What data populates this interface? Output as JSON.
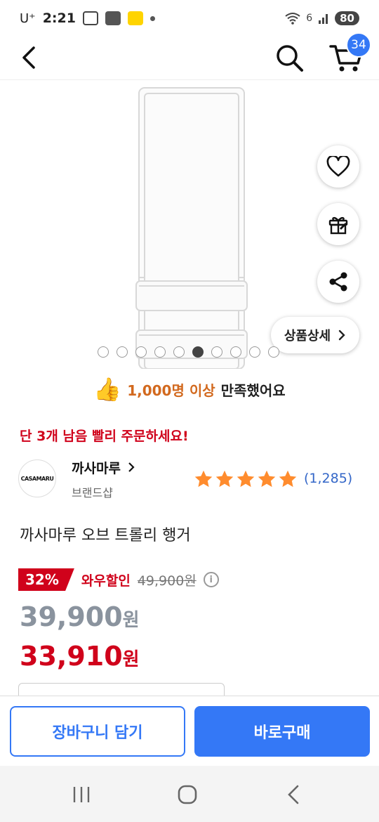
{
  "status_bar": {
    "carrier": "U⁺",
    "time": "2:21",
    "battery": "80",
    "sig_label": "6"
  },
  "header": {
    "cart_count": "34"
  },
  "gallery": {
    "total_images": 10,
    "active_index": 6,
    "detail_label": "상품상세"
  },
  "satisfaction": {
    "count": "1,000명 이상",
    "text": "만족했어요"
  },
  "stock_notice": "단 3개 남음 빨리 주문하세요!",
  "brand": {
    "logo_text": "CASAMARU",
    "name": "까사마루",
    "subtitle": "브랜드샵"
  },
  "rating": {
    "stars": 5,
    "review_count": "(1,285)"
  },
  "product": {
    "title": "까사마루 오브 트롤리 행거"
  },
  "pricing": {
    "discount": "32%",
    "wow_label": "와우할인",
    "original_price": "49,900원",
    "price_gray": "39,900",
    "price_red": "33,910",
    "won": "원"
  },
  "actions": {
    "add_to_cart": "장바구니 담기",
    "buy_now": "바로구매"
  },
  "colors": {
    "accent": "#3478f6",
    "sale_red": "#d0021b",
    "star": "#ff8c2e"
  }
}
